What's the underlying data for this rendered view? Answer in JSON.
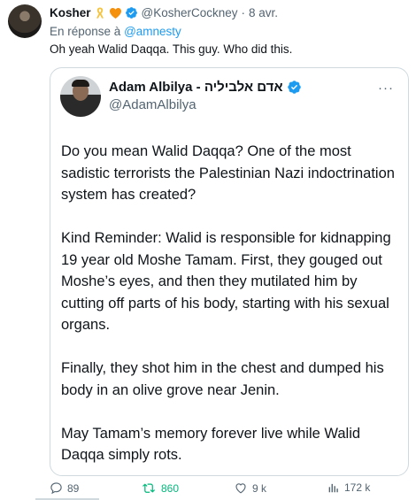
{
  "author": {
    "name": "Kosher",
    "handle": "@KosherCockney",
    "separator": "·",
    "date": "8 avr."
  },
  "reply": {
    "prefix": "En réponse à",
    "mention": "@amnesty"
  },
  "tweet_text": "Oh yeah Walid Daqqa. This guy. Who did this.",
  "quoted": {
    "name": "Adam Albilya - אדם אלביליה",
    "handle": "@AdamAlbilya",
    "more": "···",
    "paragraphs": [
      "Do you mean Walid Daqqa? One of the most sadistic terrorists the Palestinian Nazi indoctrination system has created?",
      "Kind Reminder: Walid is responsible for kidnapping 19 year old Moshe Tamam. First, they gouged out Moshe’s eyes, and then they mutilated him by cutting off parts of his body, starting with his sexual organs.",
      "Finally, they shot him in the chest and dumped his body in an olive grove near Jenin.",
      "May Tamam’s memory forever live while Walid Daqqa simply rots."
    ]
  },
  "actions": {
    "replies": "89",
    "retweets": "860",
    "likes": "9 k",
    "views": "172 k"
  },
  "icons": [
    "ribbon-icon",
    "orange-heart-icon",
    "verified-icon",
    "reply-icon",
    "retweet-icon",
    "like-icon",
    "views-icon"
  ],
  "colors": {
    "link": "#1d9bf0",
    "muted": "#536471",
    "retweet_active": "#00ba7c",
    "border": "#cfd9de"
  }
}
